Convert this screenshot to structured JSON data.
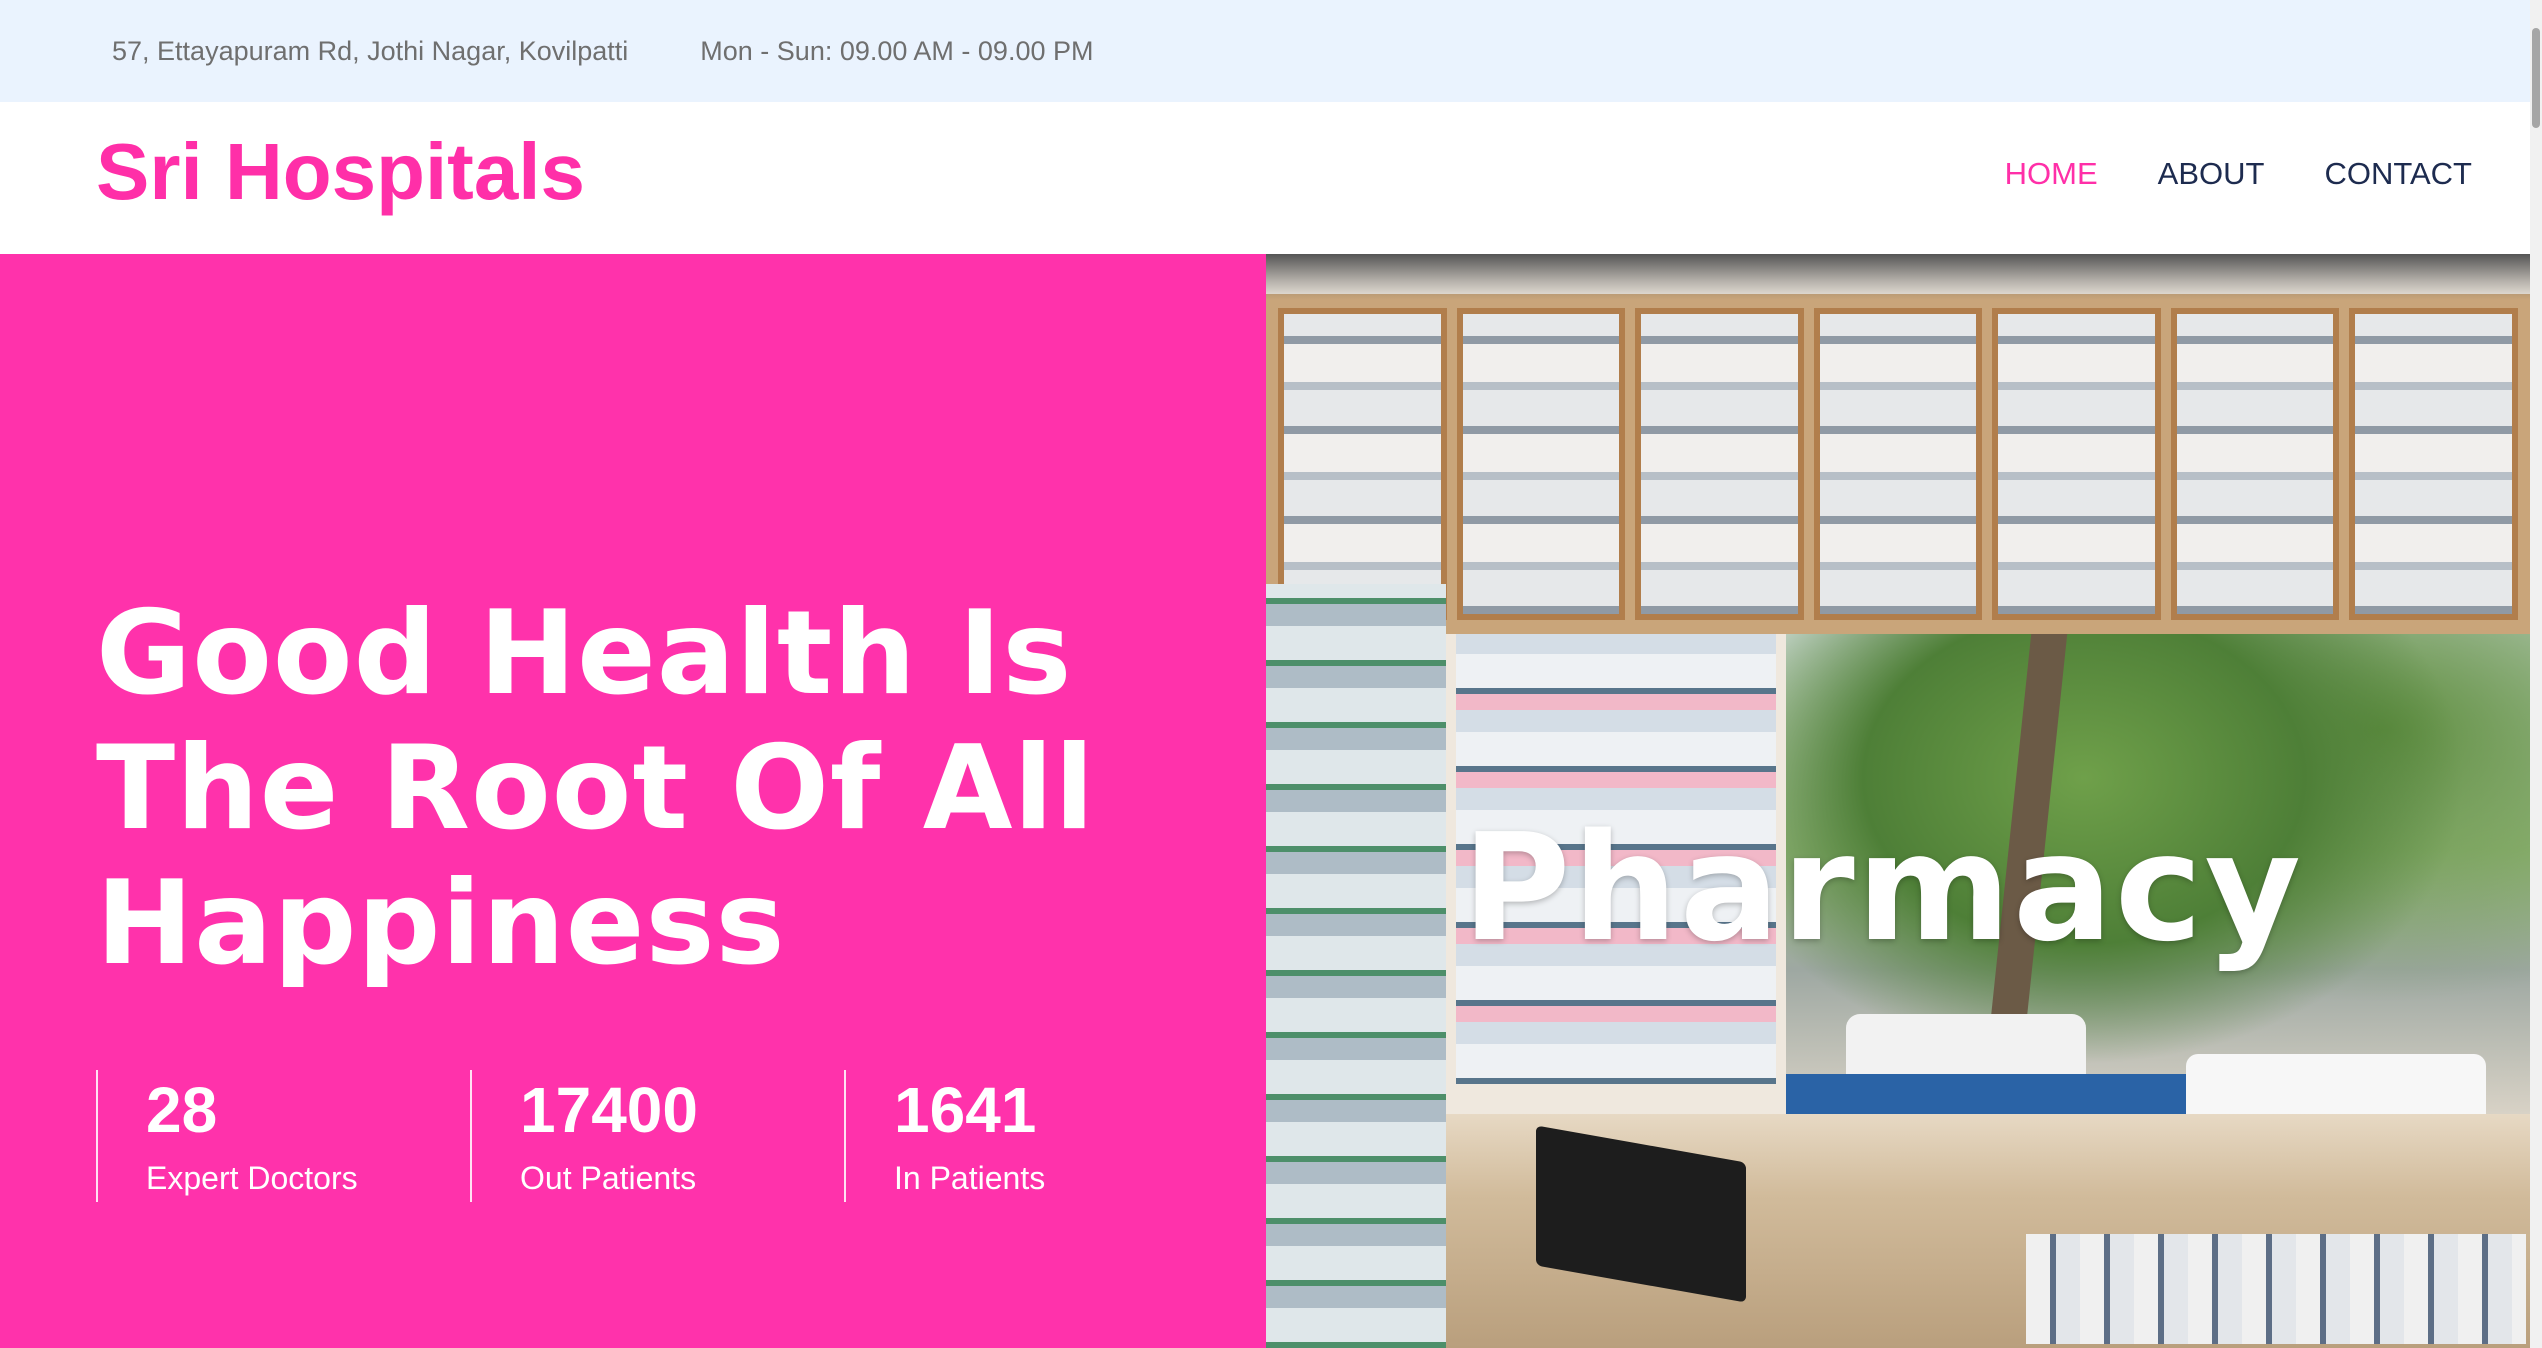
{
  "topbar": {
    "address": "57, Ettayapuram Rd, Jothi Nagar, Kovilpatti",
    "hours": "Mon - Sun: 09.00 AM - 09.00 PM"
  },
  "header": {
    "brand": "Sri Hospitals",
    "nav": [
      {
        "label": "HOME",
        "active": true
      },
      {
        "label": "ABOUT",
        "active": false
      },
      {
        "label": "CONTACT",
        "active": false
      }
    ]
  },
  "hero": {
    "headline_lines": [
      "Good Health Is",
      "The Root Of All",
      "Happiness"
    ],
    "stats": [
      {
        "value": "28",
        "label": "Expert Doctors"
      },
      {
        "value": "17400",
        "label": "Out Patients"
      },
      {
        "value": "1641",
        "label": "In Patients"
      }
    ],
    "image_title": "Pharmacy"
  },
  "colors": {
    "accent": "#ff32ab",
    "nav_text": "#1d2b4f",
    "topbar_bg": "#eaf3fe"
  }
}
